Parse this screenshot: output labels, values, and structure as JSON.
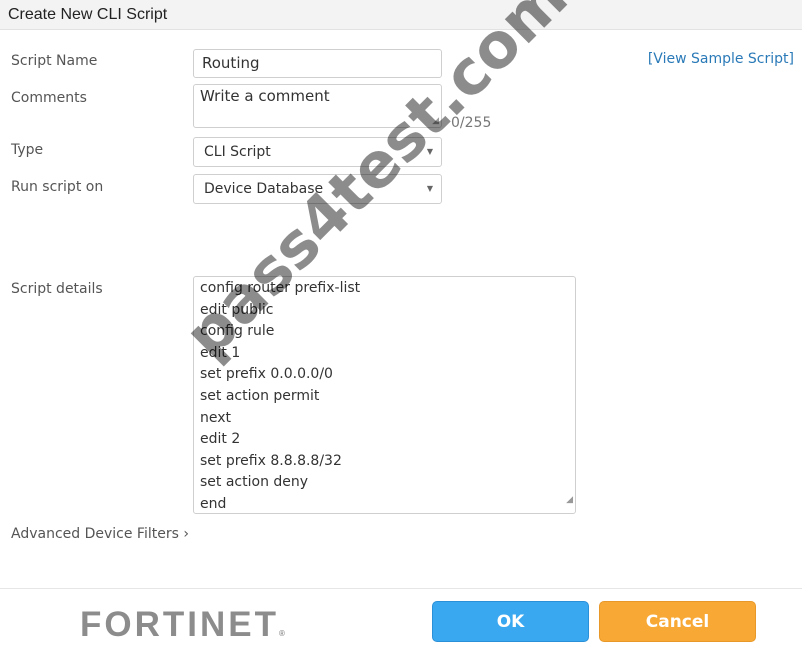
{
  "window": {
    "title": "Create New CLI Script"
  },
  "form": {
    "script_name": {
      "label": "Script Name",
      "value": "Routing"
    },
    "comments": {
      "label": "Comments",
      "placeholder": "Write a comment",
      "counter": "0/255"
    },
    "type": {
      "label": "Type",
      "value": "CLI Script"
    },
    "run_on": {
      "label": "Run script on",
      "value": "Device Database"
    },
    "script_details": {
      "label": "Script details",
      "lines": [
        "config router prefix-list",
        "edit public",
        "config rule",
        "edit 1",
        "set prefix 0.0.0.0/0",
        "set action permit",
        "next",
        "edit 2",
        "set prefix 8.8.8.8/32",
        "set action deny",
        "end"
      ]
    },
    "view_sample": "[View Sample Script]",
    "advanced": "Advanced Device Filters",
    "advanced_icon": "chevron-right-icon"
  },
  "footer": {
    "logo": "FORTINET",
    "ok": "OK",
    "cancel": "Cancel"
  },
  "colors": {
    "ok": "#3aa8f0",
    "cancel": "#f8a935",
    "link": "#2a7ab8"
  },
  "watermark": "pass4test.com"
}
